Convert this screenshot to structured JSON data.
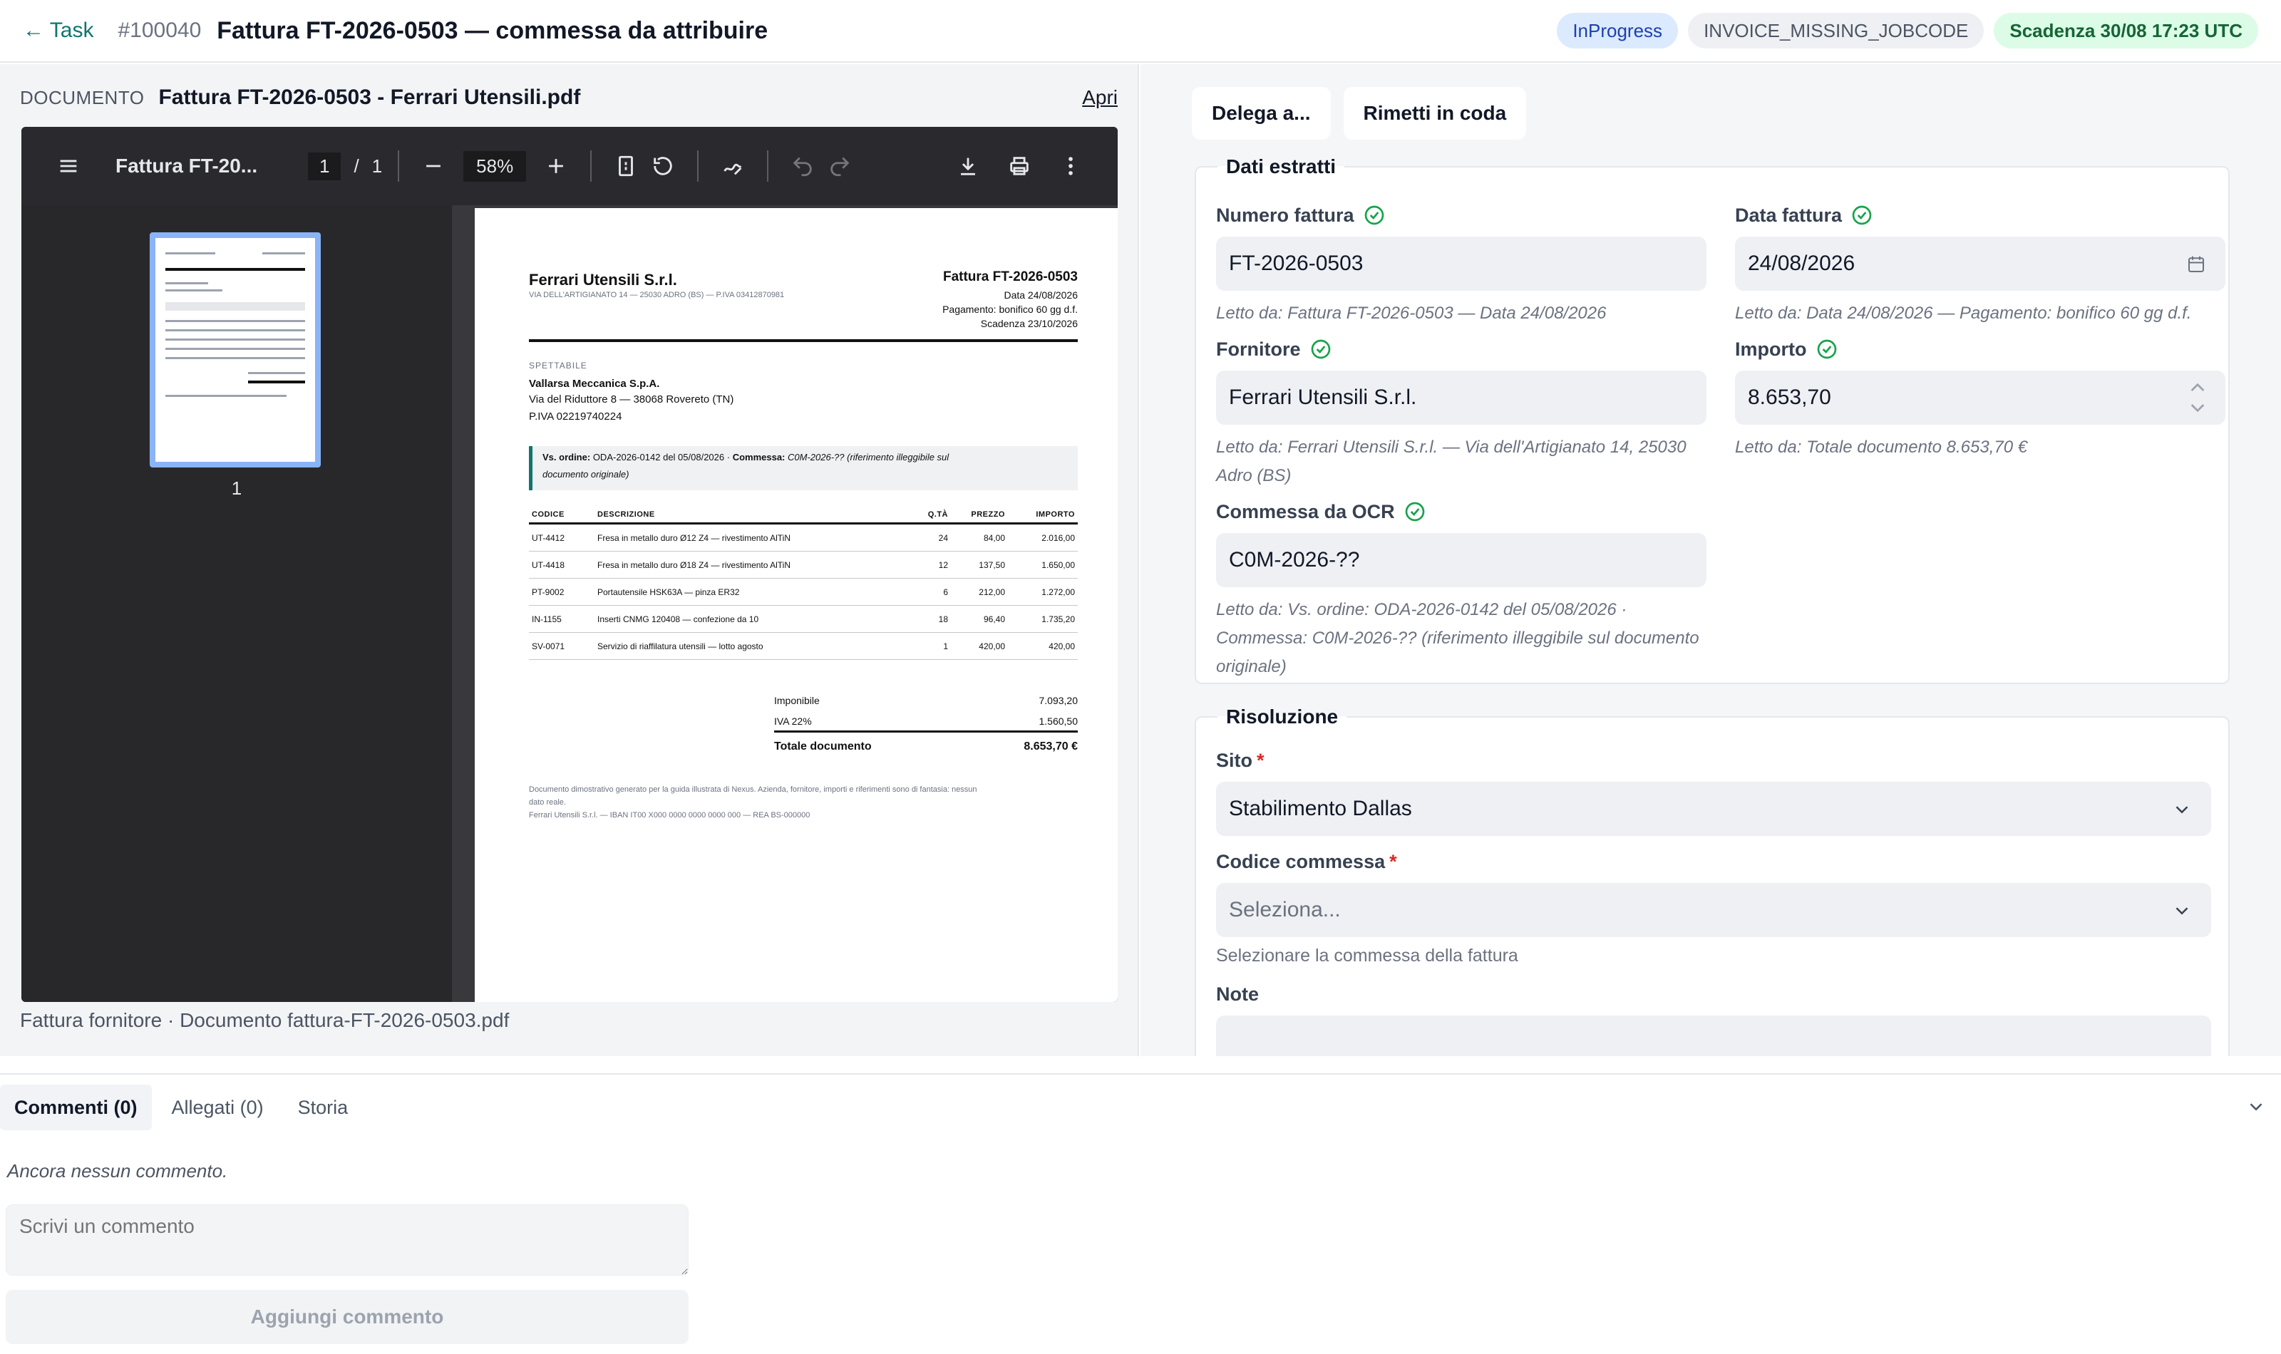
{
  "header": {
    "back_label": "← Task",
    "task_id": "#100040",
    "title": "Fattura FT-2026-0503 — commessa da attribuire",
    "status_badge": "InProgress",
    "code_badge": "INVOICE_MISSING_JOBCODE",
    "deadline_badge": "Scadenza 30/08 17:23 UTC"
  },
  "document": {
    "label": "DOCUMENTO",
    "name": "Fattura FT-2026-0503 - Ferrari Utensili.pdf",
    "open_link": "Apri",
    "footer_caption": "Fattura fornitore · Documento fattura-FT-2026-0503.pdf"
  },
  "viewer": {
    "title": "Fattura FT-20...",
    "page_current": "1",
    "page_sep": "/",
    "page_total": "1",
    "zoom": "58%",
    "thumb_label": "1",
    "icons": [
      "menu-icon",
      "zoom-out-icon",
      "zoom-in-icon",
      "fit-page-icon",
      "rotate-icon",
      "annotate-icon",
      "undo-icon",
      "redo-icon",
      "download-icon",
      "print-icon",
      "more-icon"
    ]
  },
  "invoice": {
    "supplier": "Ferrari Utensili S.r.l.",
    "supplier_addr": "VIA DELL'ARTIGIANATO 14 — 25030 ADRO (BS) — P.IVA 03412870981",
    "number": "Fattura FT-2026-0503",
    "date": "Data 24/08/2026",
    "payment": "Pagamento: bonifico 60 gg d.f.",
    "due": "Scadenza 23/10/2026",
    "to_label": "SPETTABILE",
    "customer": "Vallarsa Meccanica S.p.A.",
    "customer_addr": "Via del Riduttore 8 — 38068 Rovereto (TN)",
    "customer_vat": "P.IVA 02219740224",
    "order_ref_label": "Vs. ordine:",
    "order_ref": "ODA-2026-0142 del 05/08/2026 ·",
    "jobcode_label": "Commessa:",
    "jobcode_ref": "C0M-2026-?? (riferimento illeggibile sul",
    "jobcode_ref2": "documento originale)",
    "columns": [
      "CODICE",
      "DESCRIZIONE",
      "Q.TÀ",
      "PREZZO",
      "IMPORTO"
    ],
    "rows": [
      [
        "UT-4412",
        "Fresa in metallo duro Ø12 Z4 — rivestimento AlTiN",
        "24",
        "84,00",
        "2.016,00"
      ],
      [
        "UT-4418",
        "Fresa in metallo duro Ø18 Z4 — rivestimento AlTiN",
        "12",
        "137,50",
        "1.650,00"
      ],
      [
        "PT-9002",
        "Portautensile HSK63A — pinza ER32",
        "6",
        "212,00",
        "1.272,00"
      ],
      [
        "IN-1155",
        "Inserti CNMG 120408 — confezione da 10",
        "18",
        "96,40",
        "1.735,20"
      ],
      [
        "SV-0071",
        "Servizio di riaffilatura utensili — lotto agosto",
        "1",
        "420,00",
        "420,00"
      ]
    ],
    "taxable_label": "Imponibile",
    "taxable": "7.093,20",
    "vat_label": "IVA 22%",
    "vat": "1.560,50",
    "total_label": "Totale documento",
    "total": "8.653,70 €",
    "disclaimer": "Documento dimostrativo generato per la guida illustrata di Nexus. Azienda, fornitore, importi e riferimenti sono di fantasia: nessun",
    "disclaimer2": "dato reale.",
    "bank": "Ferrari Utensili S.r.l. — IBAN IT00 X000 0000 0000 0000 000 — REA BS-000000"
  },
  "actions": {
    "delegate": "Delega a...",
    "requeue": "Rimetti in coda"
  },
  "extracted": {
    "legend": "Dati estratti",
    "invoice_number": {
      "label": "Numero fattura",
      "value": "FT-2026-0503",
      "help": "Letto da: Fattura FT-2026-0503 — Data 24/08/2026"
    },
    "invoice_date": {
      "label": "Data fattura",
      "value": "24/08/2026",
      "help": "Letto da: Data 24/08/2026 — Pagamento: bonifico 60 gg d.f."
    },
    "supplier": {
      "label": "Fornitore",
      "value": "Ferrari Utensili S.r.l.",
      "help": "Letto da: Ferrari Utensili S.r.l. — Via dell'Artigianato 14, 25030 Adro (BS)"
    },
    "amount": {
      "label": "Importo",
      "value": "8.653,70",
      "help": "Letto da: Totale documento 8.653,70 €"
    },
    "ocr_jobcode": {
      "label": "Commessa da OCR",
      "value": "C0M-2026-??",
      "help": "Letto da: Vs. ordine: ODA-2026-0142 del 05/08/2026 · Commessa: C0M-2026-?? (riferimento illeggibile sul documento originale)"
    }
  },
  "resolution": {
    "legend": "Risoluzione",
    "site_label": "Sito",
    "site_value": "Stabilimento Dallas",
    "jobcode_label": "Codice commessa",
    "jobcode_placeholder": "Seleziona...",
    "jobcode_help": "Selezionare la commessa della fattura",
    "notes_label": "Note",
    "required_mark": "*"
  },
  "comments": {
    "tab_comments": "Commenti (0)",
    "tab_attachments": "Allegati (0)",
    "tab_history": "Storia",
    "empty": "Ancora nessun commento.",
    "placeholder": "Scrivi un commento",
    "add_button": "Aggiungi commento"
  }
}
